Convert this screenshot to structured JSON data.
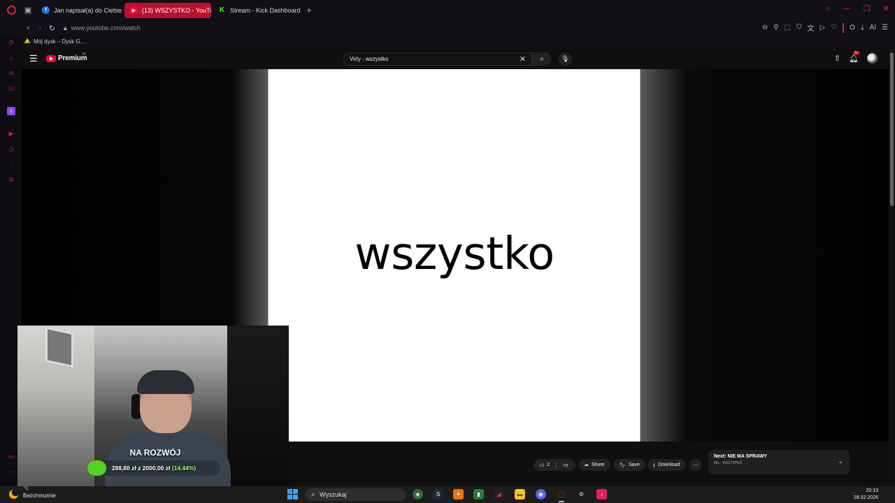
{
  "browser": {
    "tabs": [
      {
        "label": "Jan napisał(a) do Ciebie",
        "icon": "facebook-icon",
        "active": false
      },
      {
        "label": "(13) WSZYSTKO - YouTube",
        "icon": "youtube-icon",
        "active": true
      },
      {
        "label": "Stream - Kick Dashboard",
        "icon": "kick-icon",
        "active": false
      }
    ],
    "url": "www.youtube.com/watch",
    "bookmarks": [
      {
        "label": "Mój dysk – Dysk G..."
      }
    ],
    "ai_label": "AI"
  },
  "youtube": {
    "logo_text": "Premium",
    "region": "PL",
    "search_value": "Virty - wszystko",
    "notification_count": "9+",
    "video_text": "wszystko",
    "actions": {
      "likes": "2",
      "share": "Share",
      "save": "Save",
      "download": "Download"
    },
    "up_next": {
      "title": "Next: NIE MA SPRAWY",
      "subtitle": "Mix - WSZYSTKO"
    }
  },
  "overlay": {
    "goal_title": "NA ROZWÓJ",
    "goal_amount": "288,80 zł z 2000,00 zł",
    "goal_percent": "(14.44%)",
    "goal_fraction": 0.1444,
    "accent": "#53d323"
  },
  "taskbar": {
    "weather_temp": "°C",
    "weather_text": "Bezchmurnie",
    "search_placeholder": "Wyszukaj",
    "time": "20:13",
    "date": "28.02.2026"
  }
}
